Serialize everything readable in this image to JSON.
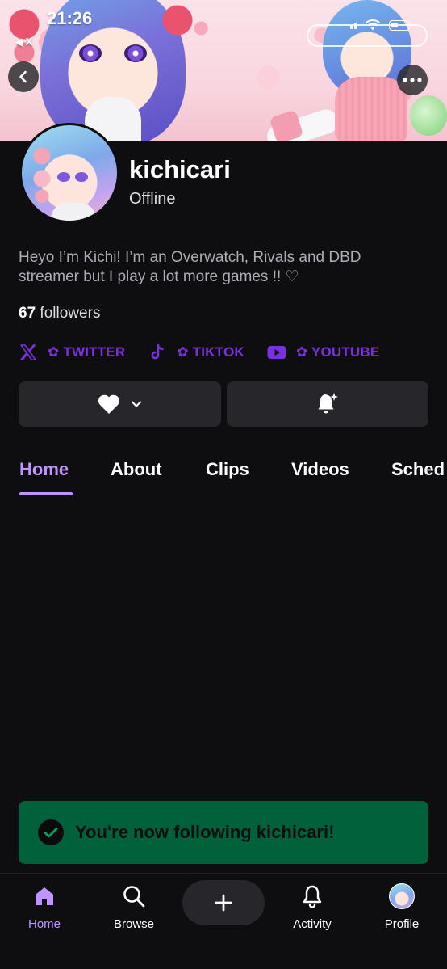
{
  "status_bar": {
    "time": "21:26",
    "back_app": "◀ X"
  },
  "profile": {
    "username": "kichicari",
    "presence": "Offline",
    "bio": "Heyo I’m Kichi! I’m an Overwatch, Rivals and DBD streamer but I play a lot more games !! ♡",
    "followers_count": "67",
    "followers_label": "followers"
  },
  "socials": [
    {
      "icon": "x-logo-icon",
      "label": "✿ TWITTER"
    },
    {
      "icon": "tiktok-logo-icon",
      "label": "✿ TIKTOK"
    },
    {
      "icon": "youtube-logo-icon",
      "label": "✿ YOUTUBE"
    }
  ],
  "actions": {
    "follow_icon": "heart-icon",
    "notify_icon": "bell-icon"
  },
  "tabs": [
    {
      "label": "Home",
      "active": true
    },
    {
      "label": "About"
    },
    {
      "label": "Clips"
    },
    {
      "label": "Videos"
    },
    {
      "label": "Sched"
    }
  ],
  "toast": {
    "text": "You're now following kichicari!"
  },
  "bottom_nav": [
    {
      "label": "Home",
      "icon": "home-icon",
      "active": true
    },
    {
      "label": "Browse",
      "icon": "search-icon"
    },
    {
      "label": "Activity",
      "icon": "bell-icon"
    },
    {
      "label": "Profile",
      "icon": "profile-avatar"
    }
  ],
  "colors": {
    "accent": "#bf94ff",
    "social_link": "#7a2fe0",
    "background": "#0e0e10",
    "button": "#26262b",
    "toast": "#00613a"
  }
}
